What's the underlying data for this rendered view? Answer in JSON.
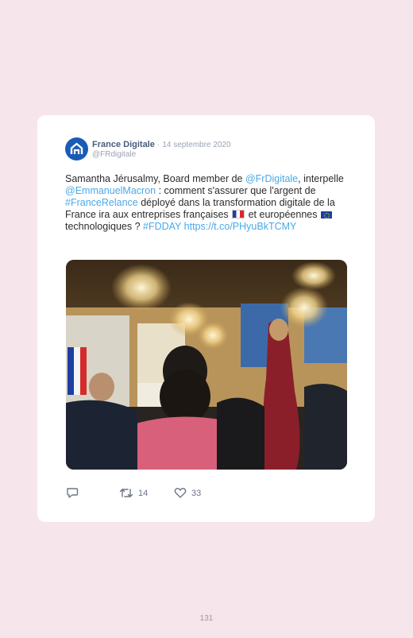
{
  "tweet": {
    "author_name": "France Digitale",
    "separator": "·",
    "date": "14 septembre 2020",
    "handle": "@FRdigitale",
    "text": {
      "seg1": "Samantha Jérusalmy, Board member de ",
      "mention1": "@FrDigitale",
      "seg2": ", interpelle ",
      "mention2": "@EmmanuelMacron",
      "seg3": " : comment s'assurer que l'argent de ",
      "hashtag1": "#FranceRelance",
      "seg4": " déployé dans la transformation digitale de la France ira aux entreprises françaises ",
      "seg5": " et européennes ",
      "seg6": " technologiques ? ",
      "hashtag2": "#FDDAY",
      "seg7": " ",
      "url": "https://t.co/PHyuBkTCMY"
    },
    "actions": {
      "reply_count": "",
      "retweet_count": "14",
      "like_count": "33"
    }
  },
  "page_number": "131",
  "colors": {
    "background": "#f6e5ea",
    "card": "#ffffff",
    "link": "#4aa9e8",
    "avatar": "#1a5bb5"
  },
  "icons": [
    "france-digitale-logo-icon",
    "reply-icon",
    "retweet-icon",
    "like-icon",
    "flag-france-icon",
    "flag-eu-icon"
  ]
}
